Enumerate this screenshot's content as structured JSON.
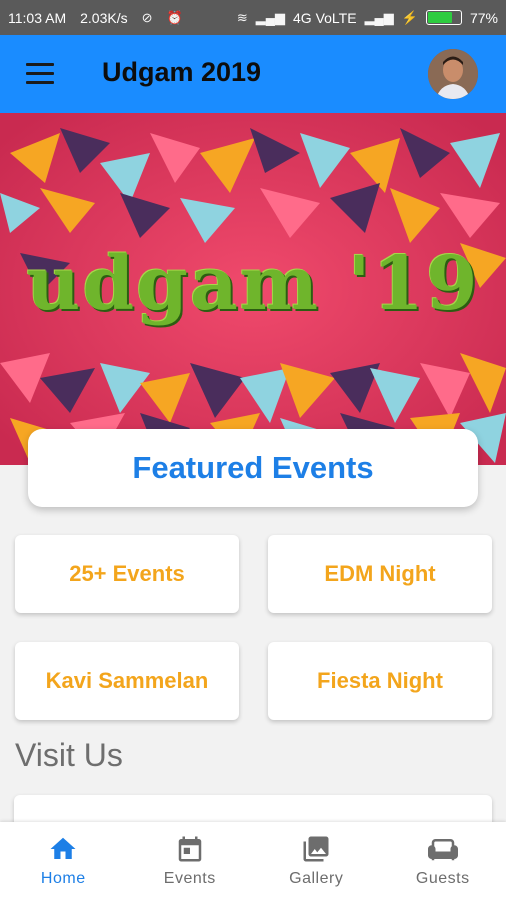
{
  "status_bar": {
    "time": "11:03 AM",
    "speed": "2.03K/s",
    "network": "4G VoLTE",
    "battery_percent": "77%",
    "battery_level": 0.77
  },
  "app_bar": {
    "title": "Udgam 2019",
    "menu_icon": "hamburger-menu-icon",
    "avatar_icon": "profile-avatar"
  },
  "banner": {
    "text": "udgam '19"
  },
  "featured": {
    "title": "Featured Events"
  },
  "events": [
    {
      "label": "25+ Events"
    },
    {
      "label": "EDM Night"
    },
    {
      "label": "Kavi Sammelan"
    },
    {
      "label": "Fiesta Night"
    }
  ],
  "visit": {
    "heading": "Visit Us"
  },
  "bottom_nav": {
    "items": [
      {
        "label": "Home",
        "icon": "home-icon",
        "active": true
      },
      {
        "label": "Events",
        "icon": "calendar-icon",
        "active": false
      },
      {
        "label": "Gallery",
        "icon": "gallery-icon",
        "active": false
      },
      {
        "label": "Guests",
        "icon": "sofa-icon",
        "active": false
      }
    ]
  },
  "colors": {
    "primary": "#1a8cff",
    "accent_text": "#1d7fe6",
    "event_text": "#f3a51c",
    "banner_bg": "#e8365d"
  }
}
